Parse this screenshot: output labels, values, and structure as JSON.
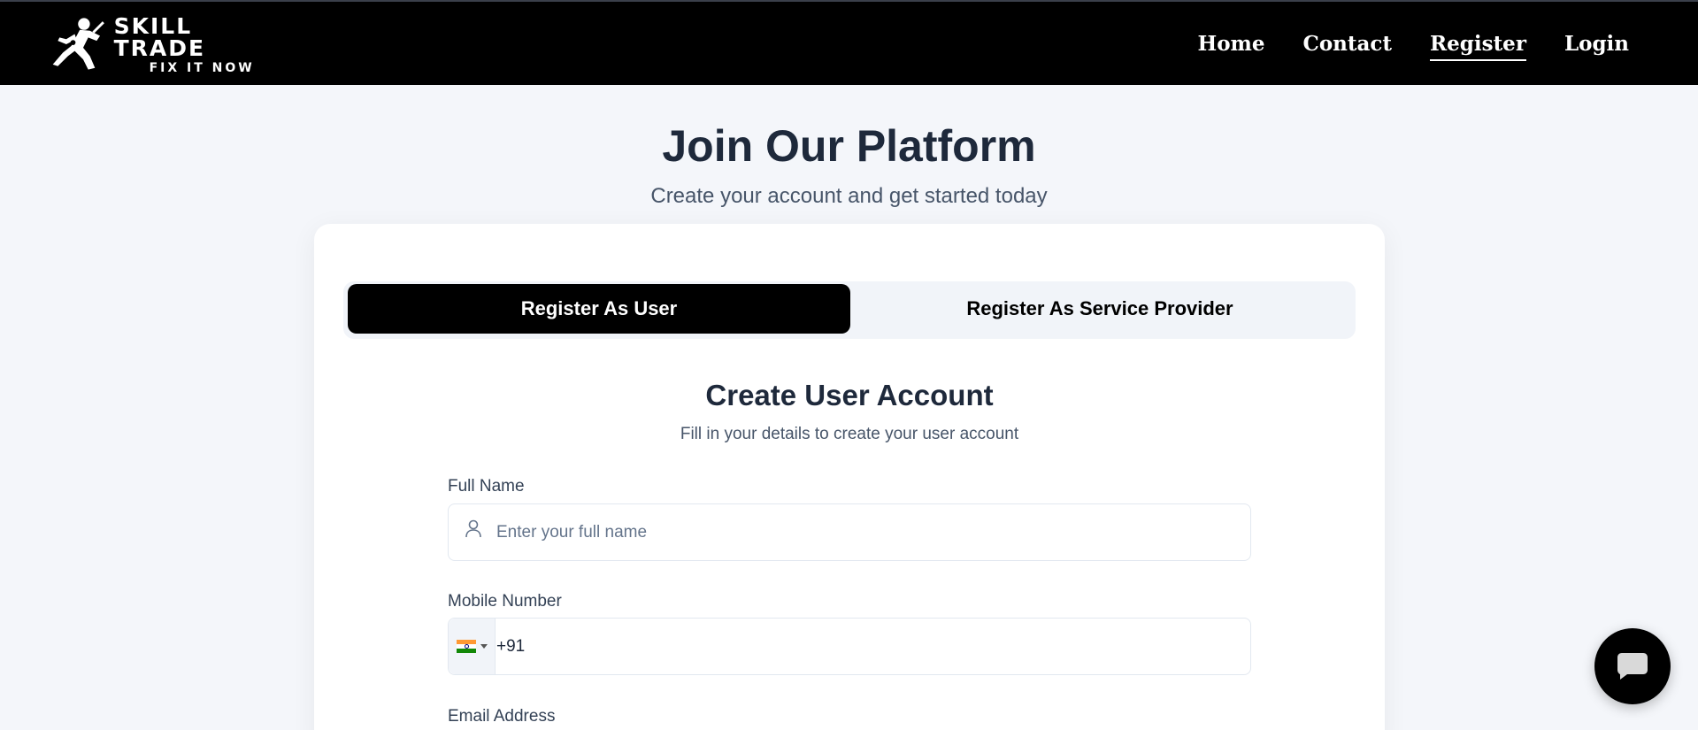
{
  "brand": {
    "title": "SKILL TRADE",
    "tagline": "FIX IT NOW"
  },
  "nav": {
    "items": [
      {
        "label": "Home",
        "active": false
      },
      {
        "label": "Contact",
        "active": false
      },
      {
        "label": "Register",
        "active": true
      },
      {
        "label": "Login",
        "active": false
      }
    ]
  },
  "header": {
    "title": "Join Our Platform",
    "subtitle": "Create your account and get started today"
  },
  "tabs": {
    "user": "Register As User",
    "provider": "Register As Service Provider",
    "active": "user"
  },
  "form": {
    "title": "Create User Account",
    "subtitle": "Fill in your details to create your user account",
    "full_name": {
      "label": "Full Name",
      "placeholder": "Enter your full name",
      "icon": "user-icon"
    },
    "mobile": {
      "label": "Mobile Number",
      "country_flag": "india-flag-icon",
      "value": "+91"
    },
    "email": {
      "label": "Email Address"
    }
  },
  "chat": {
    "icon": "chat-bubble-icon"
  },
  "colors": {
    "navbar_bg": "#000000",
    "page_bg": "#f4f6fa",
    "active_tab_bg": "#000000",
    "heading": "#1e293b",
    "muted": "#475569"
  }
}
